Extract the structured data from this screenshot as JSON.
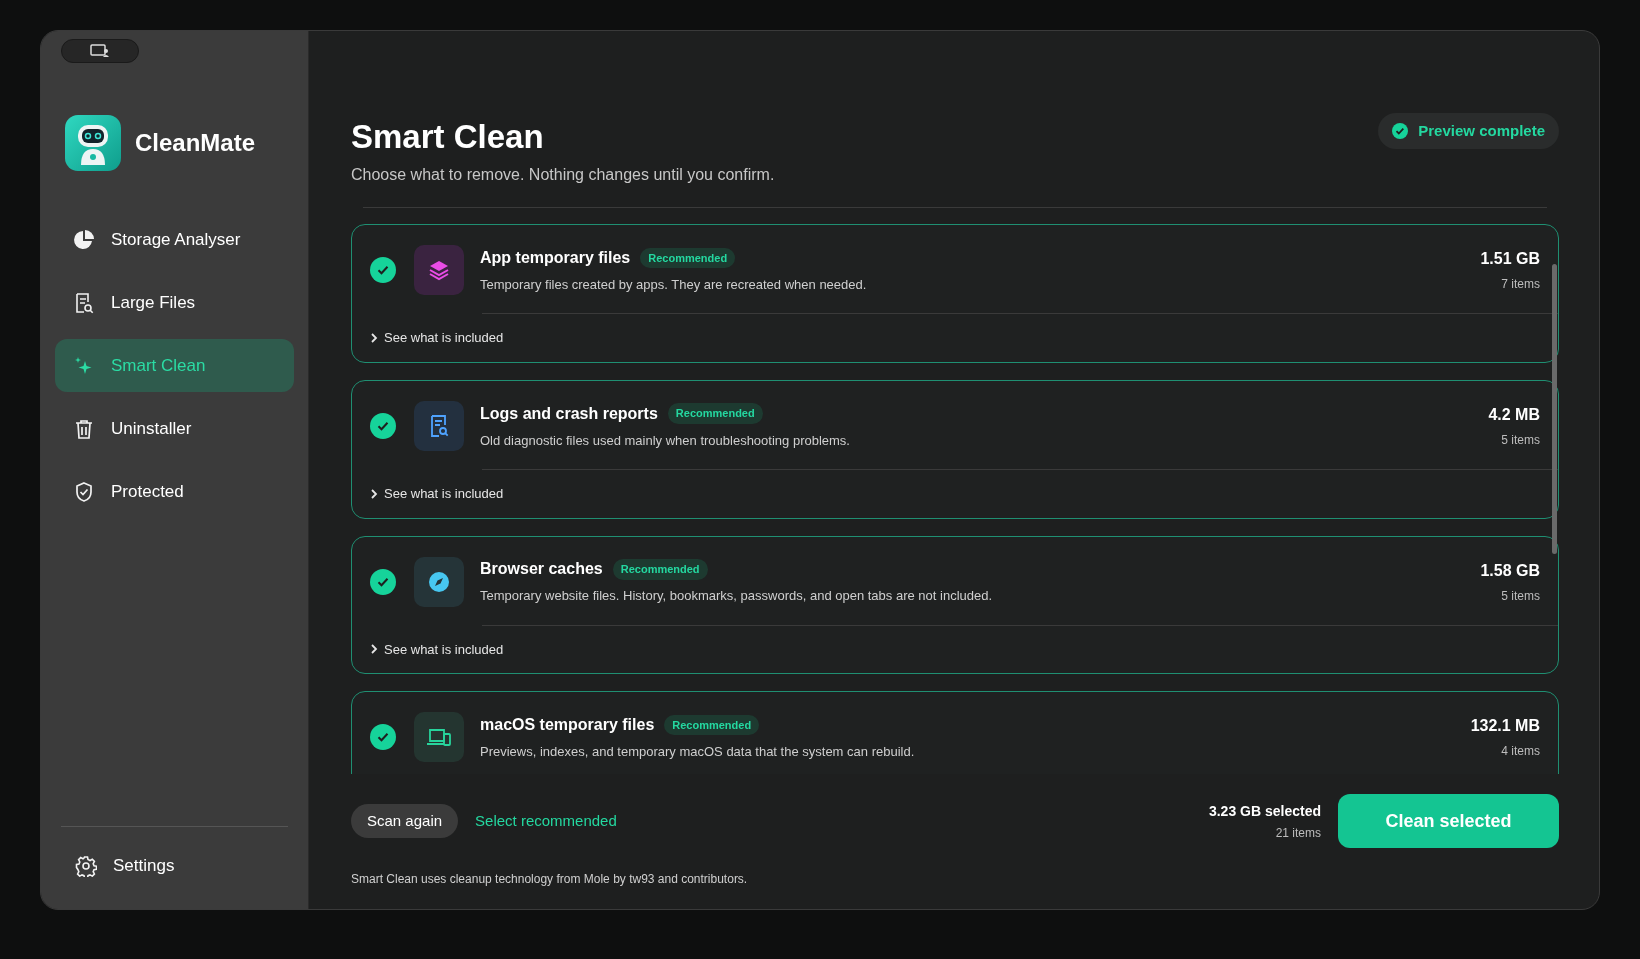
{
  "app": {
    "name": "CleanMate"
  },
  "sidebar": {
    "items": [
      {
        "label": "Storage Analyser",
        "selected": false
      },
      {
        "label": "Large Files",
        "selected": false
      },
      {
        "label": "Smart Clean",
        "selected": true
      },
      {
        "label": "Uninstaller",
        "selected": false
      },
      {
        "label": "Protected",
        "selected": false
      }
    ],
    "footer_item": {
      "label": "Settings"
    }
  },
  "header": {
    "title": "Smart Clean",
    "subtitle": "Choose what to remove. Nothing changes until you confirm.",
    "status": "Preview complete"
  },
  "categories": [
    {
      "title": "App temporary files",
      "badge": "Recommended",
      "description": "Temporary files created by apps. They are recreated when needed.",
      "size": "1.51 GB",
      "count": "7 items",
      "checked": true,
      "expanded": false,
      "link": "See what is included"
    },
    {
      "title": "Logs and crash reports",
      "badge": "Recommended",
      "description": "Old diagnostic files used mainly when troubleshooting problems.",
      "size": "4.2 MB",
      "count": "5 items",
      "checked": true,
      "expanded": false,
      "link": "See what is included"
    },
    {
      "title": "Browser caches",
      "badge": "Recommended",
      "description": "Temporary website files. History, bookmarks, passwords, and open tabs are not included.",
      "size": "1.58 GB",
      "count": "5 items",
      "checked": true,
      "expanded": false,
      "link": "See what is included"
    },
    {
      "title": "macOS temporary files",
      "badge": "Recommended",
      "description": "Previews, indexes, and temporary macOS data that the system can rebuild.",
      "size": "132.1 MB",
      "count": "4 items",
      "checked": true
    }
  ],
  "footer": {
    "scan_button": "Scan again",
    "select_link": "Select recommended",
    "selected_size": "3.23 GB selected",
    "selected_count": "21 items",
    "clean_button": "Clean selected",
    "credit": "Smart Clean uses cleanup technology from Mole by tw93 and contributors."
  }
}
